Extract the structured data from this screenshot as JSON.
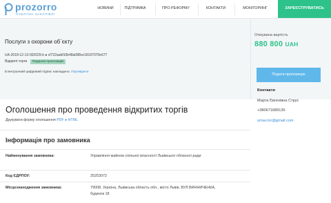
{
  "header": {
    "logo_word": "prozorro",
    "logo_sub": "ПУБЛІЧНІ ЗАКУПІВЛІ",
    "nav": [
      "НОВИНИ",
      "ПІДТРИМКА",
      "ПРО РЕФОРМУ",
      "КОНТАКТИ",
      "МОНІТОРИНГ"
    ],
    "register_label": "ЗАРЕЄСТРУВАТИСЬ"
  },
  "tender": {
    "title": "Послуги з охорони об`єкту",
    "id": "UA-2018-12-13-002029-b ● cf722aabf10b48a088ce18197070e677",
    "status_label": "Відкриті торги",
    "status_badge": "Подання пропозицій",
    "signature_text": "Електронний цифровий підпис накладено.",
    "signature_link": "Перевірити"
  },
  "estimate": {
    "label": "Очікувана вартість",
    "amount": "880 800",
    "currency": "UAH",
    "submit_label": "Подати пропозицію"
  },
  "contacts": {
    "heading": "Контакти",
    "name": "Марта Євгенівна Струс",
    "phone": "+380671689135",
    "email": "umav.tor@gmail.com"
  },
  "announcement": {
    "title": "Оголошення про проведення відкритих торгів",
    "print_text": "Друкувати форму оголошення",
    "pdf": "PDF",
    "dot": "●",
    "html": "HTML"
  },
  "customer": {
    "heading": "Інформація про замовника",
    "rows": [
      {
        "label": "Найменування замовника:",
        "value": "Управління майном спільної власності Львівської обласної ради"
      },
      {
        "label": "Код ЄДРПОУ:",
        "value": "25253072"
      },
      {
        "label": "Місцезнаходження замовника:",
        "value": "79008, Україна, Львівська область обл., місто Львів, ВУЛ.ВИННИЧЕНКА, будинок 18"
      }
    ]
  }
}
